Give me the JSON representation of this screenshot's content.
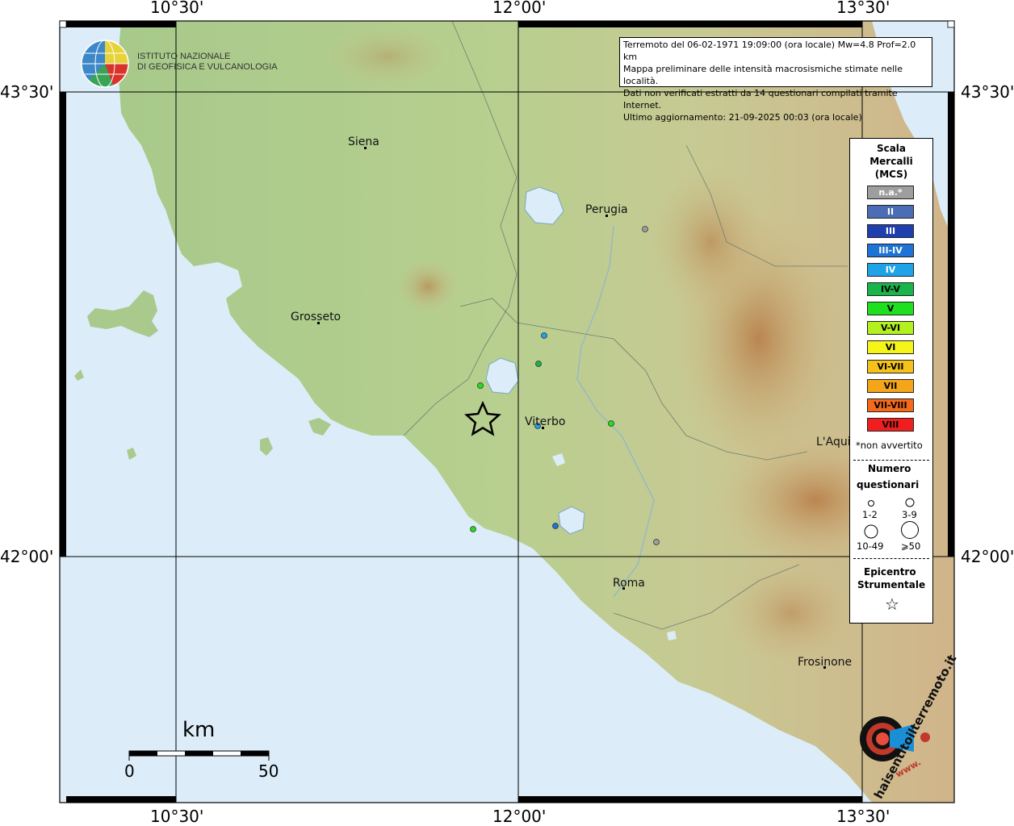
{
  "header": {
    "info_lines": [
      "Terremoto del 06-02-1971 19:09:00 (ora locale) Mw=4.8 Prof=2.0 km",
      "Mappa preliminare delle intensità macrosismiche stimate nelle località.",
      "Dati non verificati estratti da 14 questionari compilati tramite Internet.",
      "Ultimo aggiornamento: 21-09-2025 00:03 (ora locale)"
    ]
  },
  "logo": {
    "line1": "ISTITUTO NAZIONALE",
    "line2": "DI GEOFISICA E VULCANOLOGIA",
    "badge": "haisentitoilterremoto.it",
    "badge_www": "www."
  },
  "axes": {
    "top": [
      "10°30'",
      "12°00'",
      "13°30'"
    ],
    "bottom": [
      "10°30'",
      "12°00'",
      "13°30'"
    ],
    "left": [
      "43°30'",
      "42°00'"
    ],
    "right": [
      "43°30'",
      "42°00'"
    ]
  },
  "cities": [
    {
      "name": "Siena"
    },
    {
      "name": "Perugia"
    },
    {
      "name": "Grosseto"
    },
    {
      "name": "Viterbo"
    },
    {
      "name": "L'Aqui"
    },
    {
      "name": "Roma"
    },
    {
      "name": "Frosinone"
    }
  ],
  "legend": {
    "title": [
      "Scala",
      "Mercalli",
      "(MCS)"
    ],
    "classes": [
      {
        "label": "n.a.*",
        "color": "#9e9e9e",
        "text": "#ffffff"
      },
      {
        "label": "II",
        "color": "#4a6db6",
        "text": "#ffffff"
      },
      {
        "label": "III",
        "color": "#1f3fae",
        "text": "#ffffff"
      },
      {
        "label": "III-IV",
        "color": "#1f73d6",
        "text": "#ffffff"
      },
      {
        "label": "IV",
        "color": "#1ea2e8",
        "text": "#ffffff"
      },
      {
        "label": "IV-V",
        "color": "#17b54a",
        "text": "#000000"
      },
      {
        "label": "V",
        "color": "#1ee01e",
        "text": "#000000"
      },
      {
        "label": "V-VI",
        "color": "#b3f01e",
        "text": "#000000"
      },
      {
        "label": "VI",
        "color": "#f5f51a",
        "text": "#000000"
      },
      {
        "label": "VI-VII",
        "color": "#f5c21a",
        "text": "#000000"
      },
      {
        "label": "VII",
        "color": "#f5a51a",
        "text": "#000000"
      },
      {
        "label": "VII-VIII",
        "color": "#f56a1a",
        "text": "#000000"
      },
      {
        "label": "VIII",
        "color": "#f01e1e",
        "text": "#000000"
      }
    ],
    "non_avvertito": "*non avvertito",
    "numero_title": [
      "Numero",
      "questionari"
    ],
    "size_labels": [
      "1-2",
      "3-9",
      "10-49",
      "⩾50"
    ],
    "epicentro_title": [
      "Epicentro",
      "Strumentale"
    ],
    "star_glyph": "☆"
  },
  "observations": [
    {
      "intensity": "V",
      "color": "#1ee01e"
    },
    {
      "intensity": "V",
      "color": "#1ee01e"
    },
    {
      "intensity": "IV",
      "color": "#1ea2e8"
    },
    {
      "intensity": "IV-V",
      "color": "#17b54a"
    },
    {
      "intensity": "IV",
      "color": "#1ea2e8"
    },
    {
      "intensity": "III-IV",
      "color": "#1f73d6"
    },
    {
      "intensity": "V",
      "color": "#1ee01e"
    },
    {
      "intensity": "n.a.",
      "color": "#9e9e9e"
    },
    {
      "intensity": "n.a.",
      "color": "#9e9e9e"
    }
  ],
  "scale_bar": {
    "unit": "km",
    "start": "0",
    "end": "50"
  },
  "colors": {
    "sea": "#dbeefc",
    "land_low": "#8fc27a",
    "land_mid": "#c9d99b",
    "mountain": "#c89660"
  }
}
